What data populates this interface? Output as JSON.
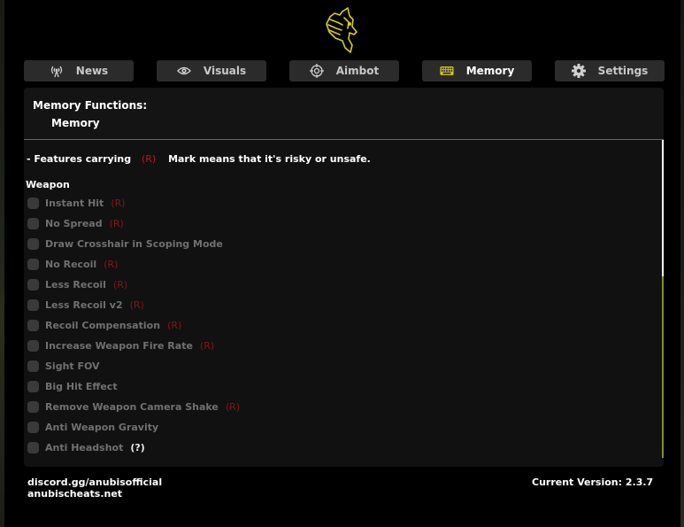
{
  "tabs": [
    {
      "label": "News",
      "icon": "broadcast-tower-icon"
    },
    {
      "label": "Visuals",
      "icon": "eye-icon"
    },
    {
      "label": "Aimbot",
      "icon": "crosshair-icon"
    },
    {
      "label": "Memory",
      "icon": "keyboard-icon",
      "active": true
    },
    {
      "label": "Settings",
      "icon": "gear-icon"
    }
  ],
  "header": {
    "title": "Memory Functions:",
    "subtitle": "Memory"
  },
  "notice": {
    "prefix": "- Features carrying",
    "risk_tag": "(R)",
    "suffix": "Mark means that it's risky or unsafe."
  },
  "section": {
    "title": "Weapon",
    "options": [
      {
        "label": "Instant Hit",
        "tag": "(R)",
        "checked": false
      },
      {
        "label": "No Spread",
        "tag": "(R)",
        "checked": false
      },
      {
        "label": "Draw Crosshair in Scoping Mode",
        "tag": "",
        "checked": false
      },
      {
        "label": "No Recoil",
        "tag": "(R)",
        "checked": false
      },
      {
        "label": "Less Recoil",
        "tag": "(R)",
        "checked": false
      },
      {
        "label": "Less Recoil v2",
        "tag": "(R)",
        "checked": false
      },
      {
        "label": "Recoil Compensation",
        "tag": "(R)",
        "checked": false
      },
      {
        "label": "Increase Weapon Fire Rate",
        "tag": "(R)",
        "checked": false
      },
      {
        "label": "Sight FOV",
        "tag": "",
        "checked": false
      },
      {
        "label": "Big Hit Effect",
        "tag": "",
        "checked": false
      },
      {
        "label": "Remove Weapon Camera Shake",
        "tag": "(R)",
        "checked": false
      },
      {
        "label": "Anti Weapon Gravity",
        "tag": "",
        "checked": false
      },
      {
        "label": "Anti Headshot",
        "tag": "(?)",
        "checked": false
      }
    ]
  },
  "footer": {
    "discord": "discord.gg/anubisofficial",
    "website": "anubischeats.net",
    "version": "Current Version: 2.3.7"
  },
  "colors": {
    "accent": "#d4c820",
    "risk": "#8a1414",
    "panel": "#111111",
    "tab": "#2b2b2b"
  }
}
